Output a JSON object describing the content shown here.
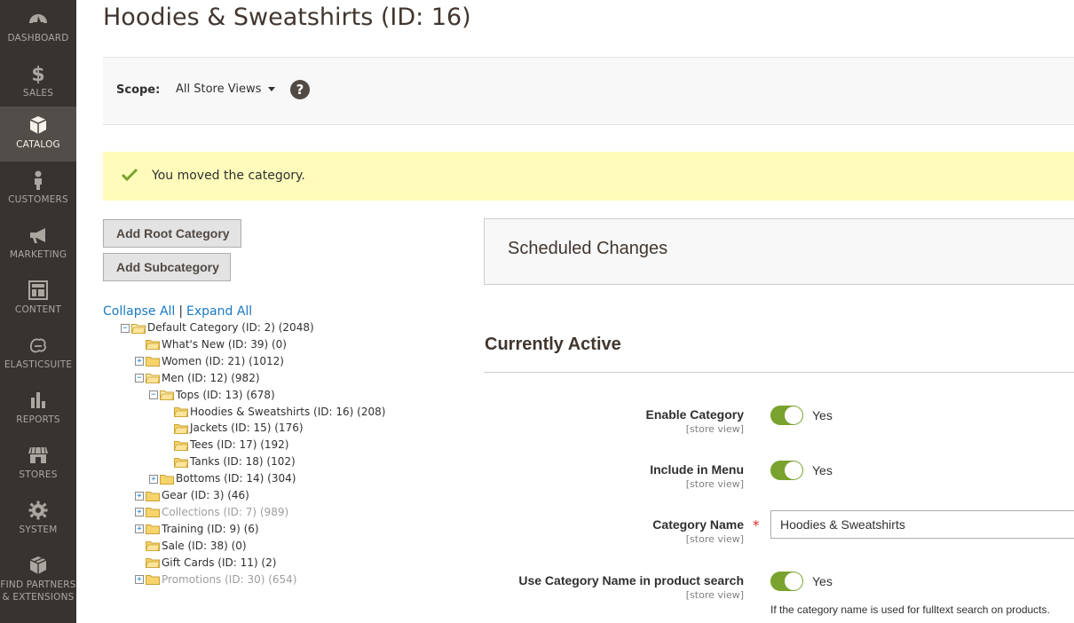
{
  "sidebar": {
    "items": [
      {
        "label": "DASHBOARD",
        "icon": "dashboard-icon"
      },
      {
        "label": "SALES",
        "icon": "dollar-icon"
      },
      {
        "label": "CATALOG",
        "icon": "box-icon",
        "active": true
      },
      {
        "label": "CUSTOMERS",
        "icon": "person-icon"
      },
      {
        "label": "MARKETING",
        "icon": "megaphone-icon"
      },
      {
        "label": "CONTENT",
        "icon": "layout-icon"
      },
      {
        "label": "ELASTICSUITE",
        "icon": "elasticsuite-icon"
      },
      {
        "label": "REPORTS",
        "icon": "bar-chart-icon"
      },
      {
        "label": "STORES",
        "icon": "storefront-icon"
      },
      {
        "label": "SYSTEM",
        "icon": "gear-icon"
      },
      {
        "label": "FIND PARTNERS & EXTENSIONS",
        "icon": "extensions-icon"
      }
    ]
  },
  "page": {
    "title": "Hoodies & Sweatshirts (ID: 16)"
  },
  "scope": {
    "label": "Scope:",
    "value": "All Store Views",
    "help": "?"
  },
  "message": {
    "text": "You moved the category.",
    "color": "#fffbbb"
  },
  "buttons": {
    "add_root": "Add Root Category",
    "add_sub": "Add Subcategory"
  },
  "tree_actions": {
    "collapse_all": "Collapse All",
    "separator": "|",
    "expand_all": "Expand All"
  },
  "tree": [
    {
      "label": "Default Category (ID: 2) (2048)",
      "level": 0,
      "toggle": "minus",
      "disabled": false
    },
    {
      "label": "What's New (ID: 39) (0)",
      "level": 1,
      "toggle": "none",
      "disabled": false
    },
    {
      "label": "Women (ID: 21) (1012)",
      "level": 1,
      "toggle": "plus",
      "disabled": false
    },
    {
      "label": "Men (ID: 12) (982)",
      "level": 1,
      "toggle": "minus",
      "disabled": false
    },
    {
      "label": "Tops (ID: 13) (678)",
      "level": 2,
      "toggle": "minus",
      "disabled": false
    },
    {
      "label": "Hoodies & Sweatshirts (ID: 16) (208)",
      "level": 3,
      "toggle": "none",
      "disabled": false
    },
    {
      "label": "Jackets (ID: 15) (176)",
      "level": 3,
      "toggle": "none",
      "disabled": false
    },
    {
      "label": "Tees (ID: 17) (192)",
      "level": 3,
      "toggle": "none",
      "disabled": false
    },
    {
      "label": "Tanks (ID: 18) (102)",
      "level": 3,
      "toggle": "none",
      "disabled": false
    },
    {
      "label": "Bottoms (ID: 14) (304)",
      "level": 2,
      "toggle": "plus",
      "disabled": false
    },
    {
      "label": "Gear (ID: 3) (46)",
      "level": 1,
      "toggle": "plus",
      "disabled": false
    },
    {
      "label": "Collections (ID: 7) (989)",
      "level": 1,
      "toggle": "plus",
      "disabled": true
    },
    {
      "label": "Training (ID: 9) (6)",
      "level": 1,
      "toggle": "plus",
      "disabled": false
    },
    {
      "label": "Sale (ID: 38) (0)",
      "level": 1,
      "toggle": "none",
      "disabled": false
    },
    {
      "label": "Gift Cards (ID: 11) (2)",
      "level": 1,
      "toggle": "none",
      "disabled": false
    },
    {
      "label": "Promotions (ID: 30) (654)",
      "level": 1,
      "toggle": "plus",
      "disabled": true
    }
  ],
  "scheduled": {
    "title": "Scheduled Changes"
  },
  "active": {
    "title": "Currently Active",
    "fields": {
      "enable_category": {
        "label": "Enable Category",
        "scope": "[store view]",
        "value": "Yes"
      },
      "include_in_menu": {
        "label": "Include in Menu",
        "scope": "[store view]",
        "value": "Yes"
      },
      "category_name": {
        "label": "Category Name",
        "scope": "[store view]",
        "value": "Hoodies & Sweatshirts",
        "required": "*"
      },
      "use_in_search": {
        "label": "Use Category Name in product search",
        "scope": "[store view]",
        "value": "Yes",
        "note": "If the category name is used for fulltext search on products."
      }
    }
  },
  "colors": {
    "sidebar_bg": "#373330",
    "sidebar_active": "#524d49",
    "toggle_on": "#79a22e",
    "link": "#1979c3"
  }
}
